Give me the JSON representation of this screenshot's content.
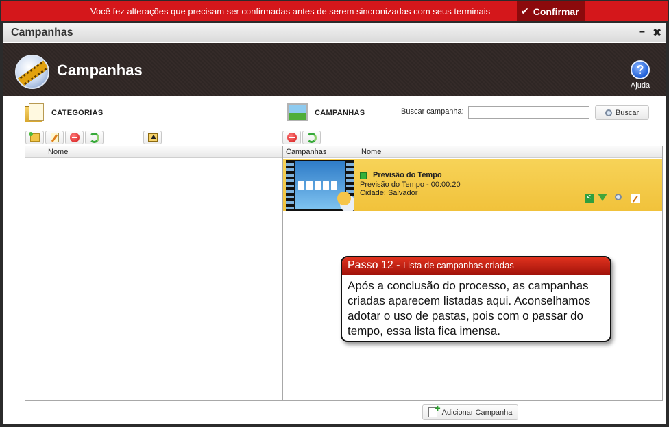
{
  "banner": {
    "message": "Você fez alterações que precisam ser confirmadas antes de serem sincronizadas com seus terminais",
    "confirm_label": "Confirmar"
  },
  "window": {
    "title": "Campanhas",
    "minimize": "–",
    "close": "✖"
  },
  "header": {
    "title": "Campanhas",
    "help_label": "Ajuda",
    "help_glyph": "?"
  },
  "categories": {
    "label": "CATEGORIAS",
    "column_name": "Nome"
  },
  "campaigns": {
    "label": "CAMPANHAS",
    "search_label": "Buscar campanha:",
    "search_value": "",
    "search_button": "Buscar",
    "columns": [
      "Campanhas",
      "Nome"
    ],
    "items": [
      {
        "title": "Previsão do Tempo",
        "subtitle": "Previsão do Tempo - 00:00:20",
        "city": "Cidade: Salvador"
      }
    ],
    "add_button": "Adicionar Campanha"
  },
  "callout": {
    "step": "Passo 12 - ",
    "step_title": "Lista de campanhas criadas",
    "text": "Após a conclusão do processo, as campanhas criadas aparecem listadas aqui. Aconselhamos adotar o uso de pastas, pois com o passar do tempo, essa lista fica imensa."
  },
  "colors": {
    "banner": "#d4171b",
    "confirm": "#8c0a0c",
    "row_highlight": "#f1c23b",
    "callout_head": "#c0221a"
  },
  "icons": [
    "check-icon",
    "campaign-film-icon",
    "help-icon",
    "folder-icon",
    "picture-icon",
    "new-folder-icon",
    "edit-icon",
    "delete-icon",
    "refresh-icon",
    "folder-up-icon",
    "search-icon",
    "share-icon",
    "download-icon",
    "zoom-icon",
    "edit-row-icon",
    "add-campaign-icon"
  ]
}
